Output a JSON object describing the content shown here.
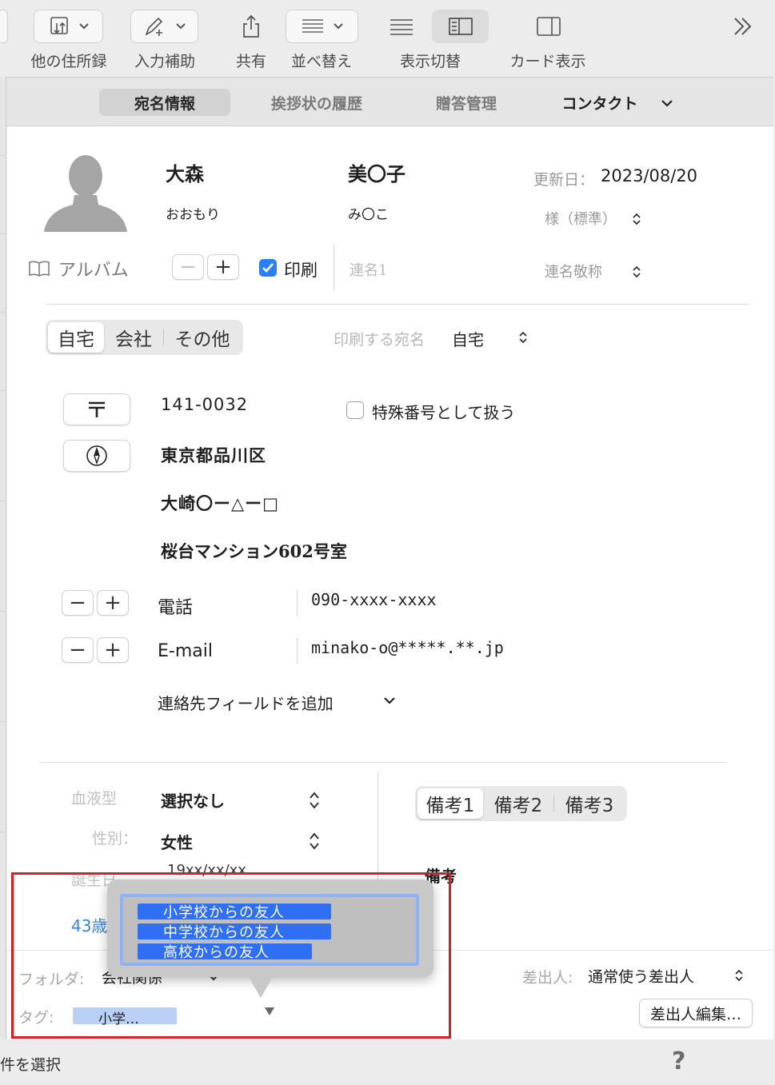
{
  "toolbar": {
    "other_addressbook": "他の住所録",
    "input_assist": "入力補助",
    "share": "共有",
    "sort": "並べ替え",
    "view_toggle": "表示切替",
    "card_view": "カード表示"
  },
  "tabs": {
    "address_info": "宛名情報",
    "greeting_history": "挨拶状の履歴",
    "gift_management": "贈答管理",
    "contact": "コンタクト"
  },
  "person": {
    "last_name": "大森",
    "first_name": "美〇子",
    "last_kana": "おおもり",
    "first_kana": "み〇こ",
    "updated_label": "更新日",
    "updated_sep": "：",
    "updated_value": "2023/08/20",
    "honorific": "様（標準）",
    "album_label": "アルバム",
    "print_label": "印刷",
    "joint_name_placeholder": "連名1",
    "joint_honorific": "連名敬称"
  },
  "address_tabs": {
    "home": "自宅",
    "company": "会社",
    "other": "その他",
    "print_target_label": "印刷する宛名",
    "print_target_value": "自宅"
  },
  "address": {
    "postal_code": "141-0032",
    "special_number_label": "特殊番号として扱う",
    "line1": "東京都品川区",
    "line2": "大崎〇ー△ー□",
    "line3": "桜台マンション602号室"
  },
  "contact_fields": {
    "phone_label": "電話",
    "phone_value": "090-xxxx-xxxx",
    "email_label": "E-mail",
    "email_value": "minako-o@*****.**.jp",
    "add_field": "連絡先フィールドを追加"
  },
  "attributes": {
    "blood_type_label": "血液型",
    "blood_type_value": "選択なし",
    "gender_label": "性別",
    "gender_sep": "：",
    "gender_value": "女性",
    "birthday_label_partial": "誕生日",
    "birthday_value_partial": "19xx/xx/xx",
    "age_partial": "43歳"
  },
  "notes": {
    "tab1": "備考1",
    "tab2": "備考2",
    "tab3": "備考3",
    "heading": "備考"
  },
  "footer": {
    "folder_label": "フォルダ:",
    "folder_value_partial": "会社関係",
    "tag_label": "タグ:",
    "tag_value": "小学…",
    "sender_label": "差出人:",
    "sender_value": "通常使う差出人",
    "sender_edit": "差出人編集…"
  },
  "tag_popover": {
    "tags": [
      "小学校からの友人",
      "中学校からの友人",
      "高校からの友人"
    ]
  },
  "status": {
    "selection_text": "件を選択",
    "help": "?"
  },
  "colors": {
    "accent": "#2b7ff6",
    "tag_chip": "#2f6ff3",
    "tag_list_border": "#8eb3f4",
    "highlight_box": "#d51f24",
    "age_link": "#3a86d6"
  }
}
